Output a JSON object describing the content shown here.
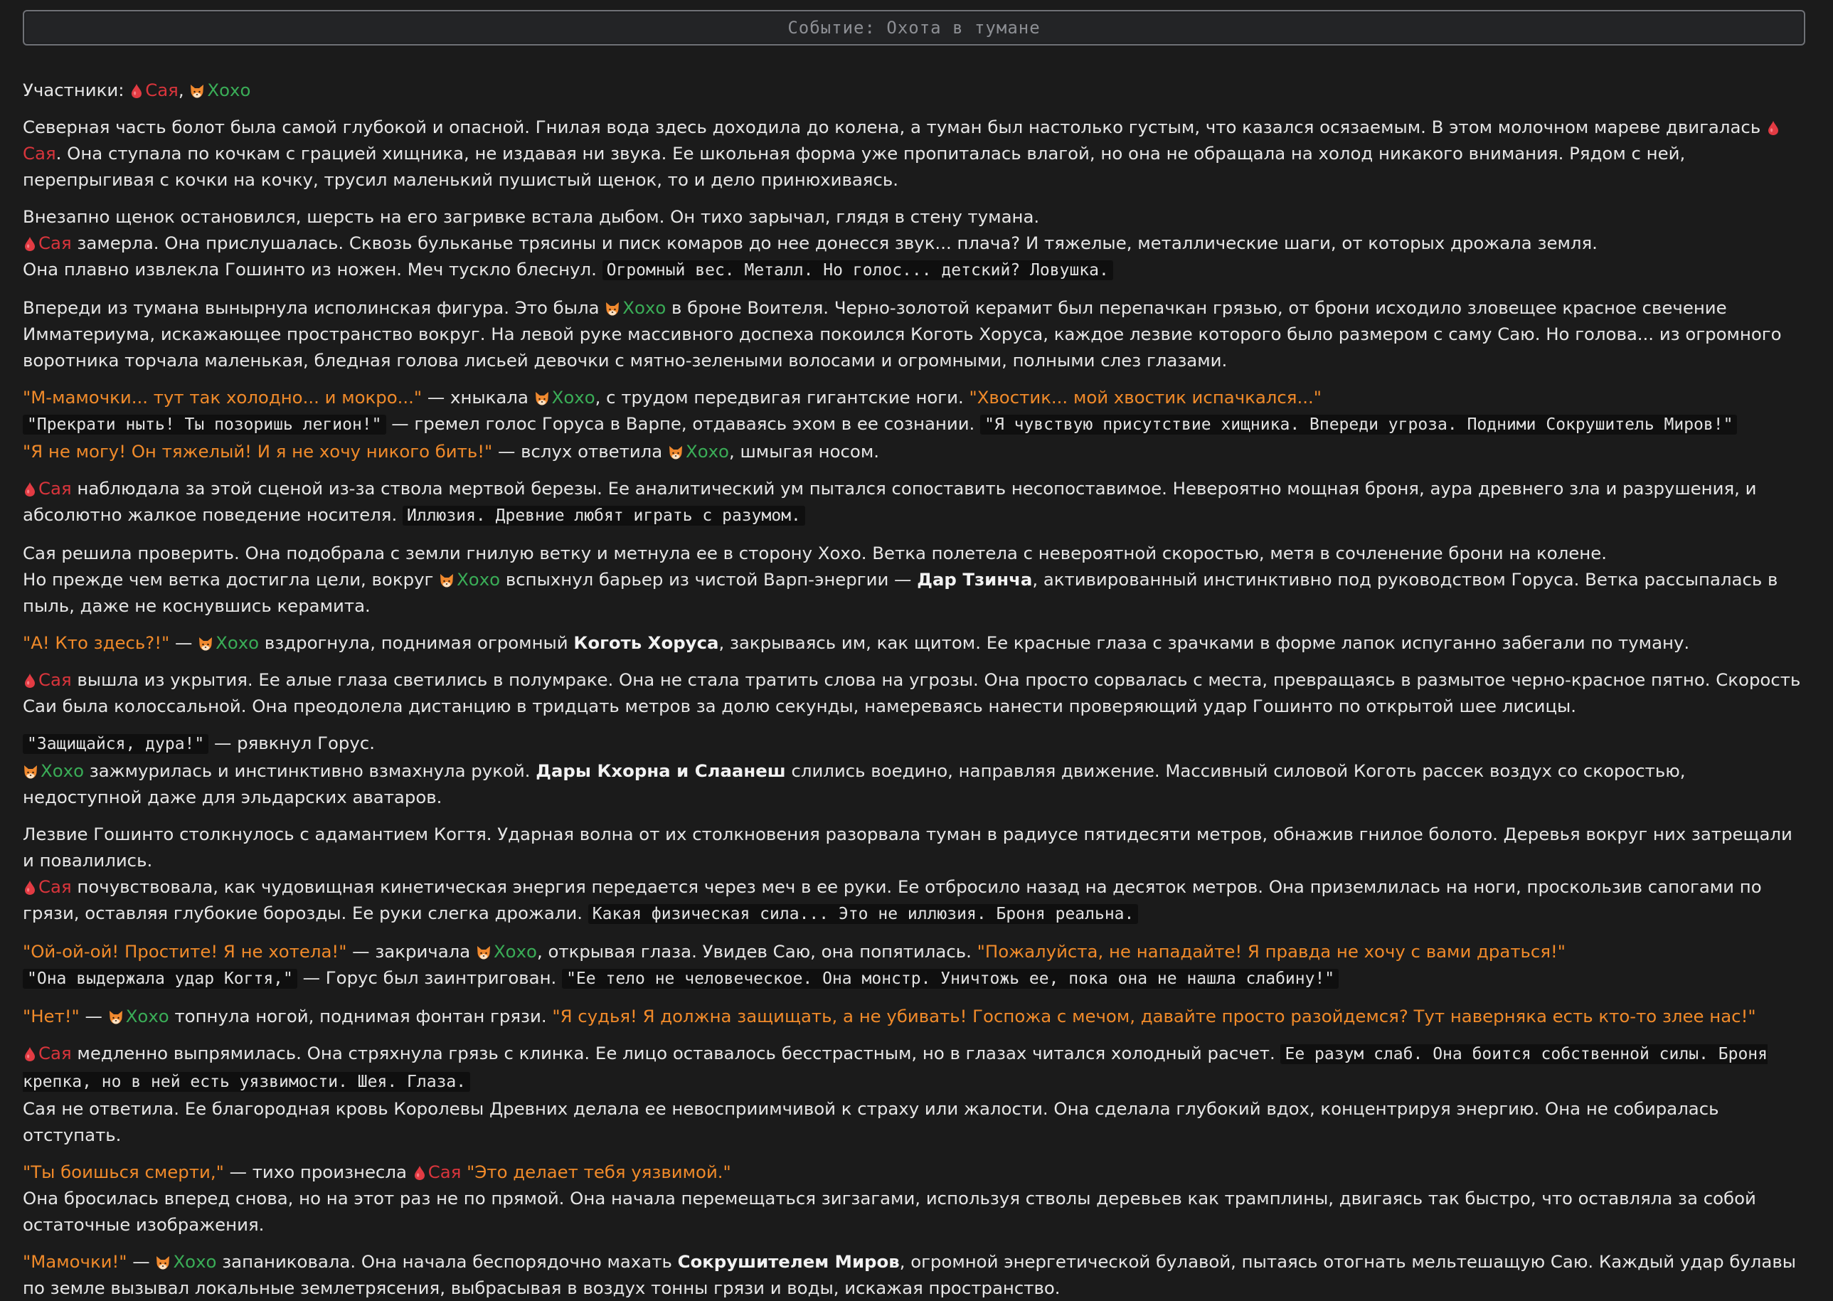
{
  "header": {
    "title": "Событие: Охота в тумане"
  },
  "names": {
    "sai": "Сая",
    "hoxo": "Хохо"
  },
  "icons": {
    "sai": "blood-drop-icon",
    "hoxo": "fox-icon"
  },
  "colors": {
    "sai": "#d9353c",
    "hoxo": "#3aad57",
    "quote": "#f08a2a",
    "bg": "#1b1b1b"
  },
  "story": {
    "p1": {
      "label": "Участники:",
      "sep": ","
    },
    "p2": {
      "t1": "Северная часть болот была самой глубокой и опасной. Гнилая вода здесь доходила до колена, а туман был настолько густым, что казался осязаемым. В этом молочном мареве двигалась",
      "t2": ". Она ступала по кочкам с грацией хищника, не издавая ни звука. Ее школьная форма уже пропиталась влагой, но она не обращала на холод никакого внимания. Рядом с ней, перепрыгивая с кочки на кочку, трусил маленький пушистый щенок, то и дело принюхиваясь."
    },
    "p3": {
      "l1": "Внезапно щенок остановился, шерсть на его загривке встала дыбом. Он тихо зарычал, глядя в стену тумана.",
      "l2": "замерла. Она прислушалась. Сквозь бульканье трясины и писк комаров до нее донесся звук... плача? И тяжелые, металлические шаги, от которых дрожала земля.",
      "l3": "Она плавно извлекла Гошинто из ножен. Меч тускло блеснул.",
      "c1": "Огромный вес. Металл. Но голос... детский? Ловушка."
    },
    "p4": {
      "t1": "Впереди из тумана вынырнула исполинская фигура. Это была",
      "t2": "в броне Воителя. Черно-золотой керамит был перепачкан грязью, от брони исходило зловещее красное свечение Имматериума, искажающее пространство вокруг. На левой руке массивного доспеха покоился Коготь Хоруса, каждое лезвие которого было размером с саму Саю. Но голова... из огромного воротника торчала маленькая, бледная голова лисьей девочки с мятно-зелеными волосами и огромными, полными слез глазами."
    },
    "p5": {
      "q1": "\"М-мамочки... тут так холодно... и мокро...\"",
      "t1": " — хныкала ",
      "t2": ", с трудом передвигая гигантские ноги.",
      "q2": "\"Хвостик... мой хвостик испачкался...\"",
      "c1": "\"Прекрати ныть! Ты позоришь легион!\"",
      "t3": " — гремел голос Горуса в Варпе, отдаваясь эхом в ее сознании.",
      "c2": "\"Я чувствую присутствие хищника. Впереди угроза. Подними Сокрушитель Миров!\"",
      "q3": "\"Я не могу! Он тяжелый! И я не хочу никого бить!\"",
      "t4": " — вслух ответила ",
      "t5": ", шмыгая носом."
    },
    "p6": {
      "t1": "наблюдала за этой сценой из-за ствола мертвой березы. Ее аналитический ум пытался сопоставить несопоставимое. Невероятно мощная броня, аура древнего зла и разрушения, и абсолютно жалкое поведение носителя.",
      "c1": "Иллюзия. Древние любят играть с разумом."
    },
    "p7": {
      "l1": "Сая решила проверить. Она подобрала с земли гнилую ветку и метнула ее в сторону Хохо. Ветка полетела с невероятной скоростью, метя в сочленение брони на колене.",
      "t1": "Но прежде чем ветка достигла цели, вокруг",
      "t2": "вспыхнул барьер из чистой Варп-энергии —",
      "b1": "Дар Тзинча",
      "t3": ", активированный инстинктивно под руководством Горуса. Ветка рассыпалась в пыль, даже не коснувшись керамита."
    },
    "p8": {
      "q1": "\"А! Кто здесь?!\"",
      "t1": " — ",
      "t2": "вздрогнула, поднимая огромный",
      "b1": "Коготь Хоруса",
      "t3": ", закрываясь им, как щитом. Ее красные глаза с зрачками в форме лапок испуганно забегали по туману."
    },
    "p9": {
      "t1": "вышла из укрытия. Ее алые глаза светились в полумраке. Она не стала тратить слова на угрозы. Она просто сорвалась с места, превращаясь в размытое черно-красное пятно. Скорость Саи была колоссальной. Она преодолела дистанцию в тридцать метров за долю секунды, намереваясь нанести проверяющий удар Гошинто по открытой шее лисицы."
    },
    "p10": {
      "c1": "\"Защищайся, дура!\"",
      "t1": " — рявкнул Горус.",
      "t2": "зажмурилась и инстинктивно взмахнула рукой.",
      "b1": "Дары Кхорна и Слаанеш",
      "t3": "слились воедино, направляя движение. Массивный силовой Коготь рассек воздух со скоростью, недоступной даже для эльдарских аватаров."
    },
    "p11": {
      "l1": "Лезвие Гошинто столкнулось с адамантием Когтя. Ударная волна от их столкновения разорвала туман в радиусе пятидесяти метров, обнажив гнилое болото. Деревья вокруг них затрещали и повалились.",
      "t1": "почувствовала, как чудовищная кинетическая энергия передается через меч в ее руки. Ее отбросило назад на десяток метров. Она приземлилась на ноги, проскользив сапогами по грязи, оставляя глубокие борозды. Ее руки слегка дрожали.",
      "c1": "Какая физическая сила... Это не иллюзия. Броня реальна."
    },
    "p12": {
      "q1": "\"Ой-ой-ой! Простите! Я не хотела!\"",
      "t1": " — закричала ",
      "t2": ", открывая глаза. Увидев Саю, она попятилась.",
      "q2": "\"Пожалуйста, не нападайте! Я правда не хочу с вами драться!\"",
      "c1": "\"Она выдержала удар Когтя,\"",
      "t3": " — Горус был заинтригован.",
      "c2": "\"Ее тело не человеческое. Она монстр. Уничтожь ее, пока она не нашла слабину!\""
    },
    "p13": {
      "q1": "\"Нет!\"",
      "t1": " — ",
      "t2": "топнула ногой, поднимая фонтан грязи.",
      "q2": "\"Я судья! Я должна защищать, а не убивать! Госпожа с мечом, давайте просто разойдемся? Тут наверняка есть кто-то злее нас!\""
    },
    "p14": {
      "t1": "медленно выпрямилась. Она стряхнула грязь с клинка. Ее лицо оставалось бесстрастным, но в глазах читался холодный расчет.",
      "c1": "Ее разум слаб. Она боится собственной силы. Броня крепка, но в ней есть уязвимости. Шея. Глаза.",
      "l2": "Сая не ответила. Ее благородная кровь Королевы Древних делала ее невосприимчивой к страху или жалости. Она сделала глубокий вдох, концентрируя энергию. Она не собиралась отступать."
    },
    "p15": {
      "q1": "\"Ты боишься смерти,\"",
      "t1": " — тихо произнесла ",
      "q2": "\"Это делает тебя уязвимой.\"",
      "l2": "Она бросилась вперед снова, но на этот раз не по прямой. Она начала перемещаться зигзагами, используя стволы деревьев как трамплины, двигаясь так быстро, что оставляла за собой остаточные изображения."
    },
    "p16": {
      "q1": "\"Мамочки!\"",
      "t1": " — ",
      "t2": "запаниковала. Она начала беспорядочно махать",
      "b1": "Сокрушителем Миров",
      "t3": ", огромной энергетической булавой, пытаясь отогнать мельтешащую Саю. Каждый удар булавы по земле вызывал локальные землетрясения, выбрасывая в воздух тонны грязи и воды, искажая пространство."
    }
  }
}
